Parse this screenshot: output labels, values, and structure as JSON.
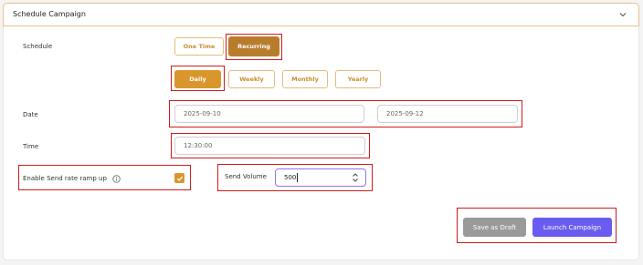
{
  "header": {
    "title": "Schedule Campaign"
  },
  "schedule": {
    "label": "Schedule",
    "modes": [
      "One Time",
      "Recurring"
    ],
    "selected_mode": "Recurring",
    "frequencies": [
      "Daily",
      "Weekly",
      "Monthly",
      "Yearly"
    ],
    "selected_frequency": "Daily"
  },
  "date": {
    "label": "Date",
    "start": "2025-09-10",
    "end": "2025-09-12"
  },
  "time": {
    "label": "Time",
    "value": "12:30:00"
  },
  "ramp": {
    "label": "Enable Send rate ramp up",
    "checked": true
  },
  "volume": {
    "label": "Send Volume",
    "value": "500"
  },
  "actions": {
    "draft": "Save as Draft",
    "launch": "Launch Campaign"
  },
  "colors": {
    "accent": "#b87d2c",
    "daily": "#d9962d",
    "primary_button": "#6b5cf0",
    "draft_button": "#9a9a9a",
    "highlight": "#d11b1b"
  }
}
